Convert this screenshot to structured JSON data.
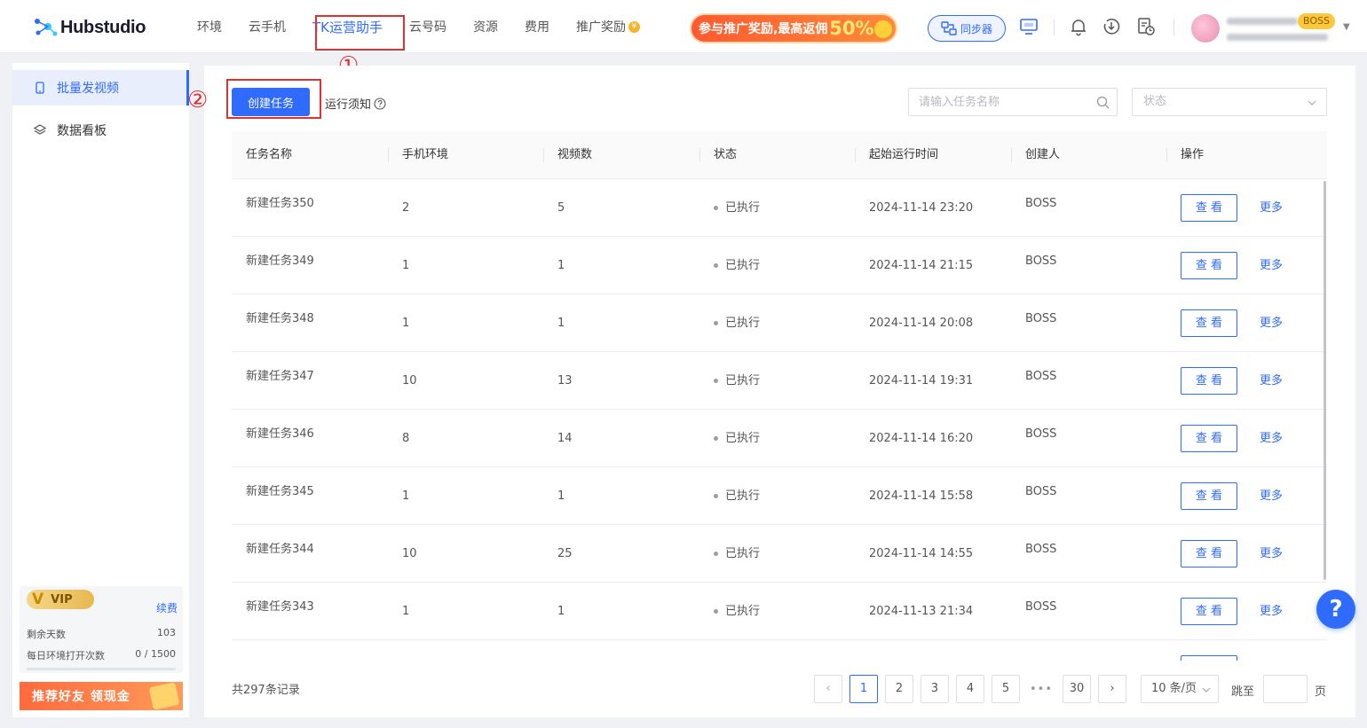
{
  "app": {
    "logo_text": "Hubstudio"
  },
  "nav": {
    "items": [
      {
        "label": "环境"
      },
      {
        "label": "云手机"
      },
      {
        "label": "TK运营助手"
      },
      {
        "label": "云号码"
      },
      {
        "label": "资源"
      },
      {
        "label": "费用"
      },
      {
        "label": "推广奖励"
      }
    ],
    "promo_text": "参与推广奖励,最高返佣",
    "promo_percent": "50%",
    "sync_label": "同步器",
    "user_badge": "BOSS"
  },
  "annotations": {
    "marker1": "①",
    "marker2": "②"
  },
  "sidebar": {
    "items": [
      {
        "label": "批量发视频",
        "icon": "phone-icon"
      },
      {
        "label": "数据看板",
        "icon": "layers-icon"
      }
    ],
    "vip": {
      "badge": "VIP",
      "renew_label": "续费",
      "days_label": "剩余天数",
      "days_value": "103",
      "opens_label": "每日环境打开次数",
      "opens_value": "0 / 1500"
    },
    "refer_label": "推荐好友 领现金"
  },
  "toolbar": {
    "create_label": "创建任务",
    "run_note_label": "运行须知",
    "search_placeholder": "请输入任务名称",
    "status_placeholder": "状态"
  },
  "table": {
    "columns": [
      "任务名称",
      "手机环境",
      "视频数",
      "状态",
      "起始运行时间",
      "创建人",
      "操作"
    ],
    "view_label": "查 看",
    "more_label": "更多",
    "rows": [
      {
        "name": "新建任务350",
        "env": "2",
        "videos": "5",
        "status": "已执行",
        "time": "2024-11-14 23:20",
        "creator": "BOSS"
      },
      {
        "name": "新建任务349",
        "env": "1",
        "videos": "1",
        "status": "已执行",
        "time": "2024-11-14 21:15",
        "creator": "BOSS"
      },
      {
        "name": "新建任务348",
        "env": "1",
        "videos": "1",
        "status": "已执行",
        "time": "2024-11-14 20:08",
        "creator": "BOSS"
      },
      {
        "name": "新建任务347",
        "env": "10",
        "videos": "13",
        "status": "已执行",
        "time": "2024-11-14 19:31",
        "creator": "BOSS"
      },
      {
        "name": "新建任务346",
        "env": "8",
        "videos": "14",
        "status": "已执行",
        "time": "2024-11-14 16:20",
        "creator": "BOSS"
      },
      {
        "name": "新建任务345",
        "env": "1",
        "videos": "1",
        "status": "已执行",
        "time": "2024-11-14 15:58",
        "creator": "BOSS"
      },
      {
        "name": "新建任务344",
        "env": "10",
        "videos": "25",
        "status": "已执行",
        "time": "2024-11-14 14:55",
        "creator": "BOSS"
      },
      {
        "name": "新建任务343",
        "env": "1",
        "videos": "1",
        "status": "已执行",
        "time": "2024-11-13 21:34",
        "creator": "BOSS"
      }
    ]
  },
  "pagination": {
    "total_label": "共297条记录",
    "pages": [
      "1",
      "2",
      "3",
      "4",
      "5"
    ],
    "ellipsis": "•••",
    "last_page": "30",
    "current": "1",
    "page_size": "10 条/页",
    "jump_label": "跳至",
    "page_suffix": "页"
  },
  "help_label": "?"
}
